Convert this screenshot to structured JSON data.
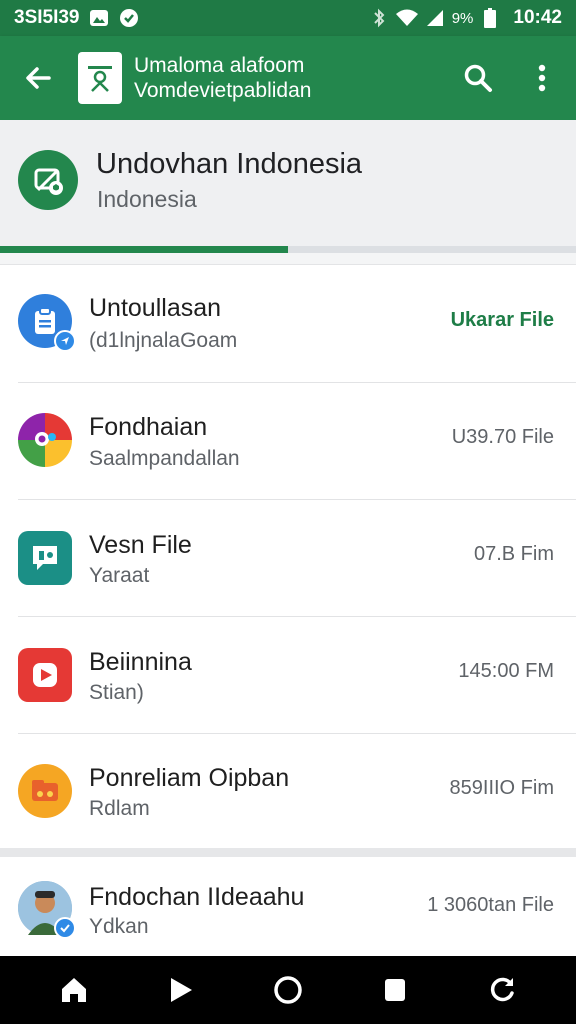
{
  "status_bar": {
    "left_text": "3SI5I39",
    "battery_pct": "9%",
    "time": "10:42"
  },
  "app_bar": {
    "title": "Umaloma alafoom",
    "subtitle": "Vomdevietpablidan"
  },
  "header": {
    "title": "Undovhan Indonesia",
    "subtitle": "Indonesia",
    "progress": 0.5
  },
  "items": [
    {
      "title": "Untoullasan",
      "subtitle": "(d1lnjnalaGoam",
      "meta": "Ukarar File",
      "icon": "clipboard-icon"
    },
    {
      "title": "Fondhaian",
      "subtitle": "Saalmpandallan",
      "meta": "U39.70 File",
      "icon": "colorful-app-icon"
    },
    {
      "title": "Vesn File",
      "subtitle": "Yaraat",
      "meta": "07.B Fim",
      "icon": "chat-icon"
    },
    {
      "title": "Beiinnina",
      "subtitle": "Stian)",
      "meta": "145:00 FM",
      "icon": "play-icon"
    },
    {
      "title": "Ponreliam Oipban",
      "subtitle": "Rdlam",
      "meta": "859IIIO Fim",
      "icon": "folder-icon"
    },
    {
      "title": "Fndochan IIdeaahu",
      "subtitle": "Ydkan",
      "meta": "1 3060tan File",
      "icon": "avatar-photo"
    }
  ],
  "colors": {
    "primary": "#23874d",
    "status_bar": "#1f7a45",
    "accent_text": "#1e7d47"
  }
}
